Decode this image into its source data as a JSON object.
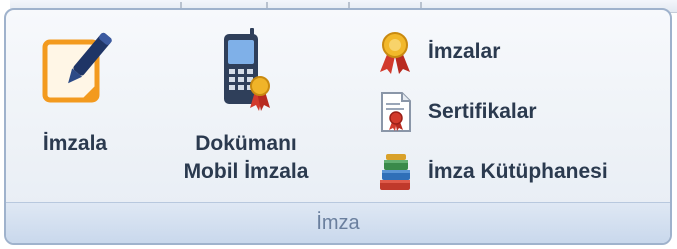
{
  "ribbon": {
    "group_label": "İmza",
    "buttons": {
      "sign": {
        "label": "İmzala",
        "icon": "sign-pen-icon"
      },
      "mobile_sign": {
        "label_line1": "Dokümanı",
        "label_line2": "Mobil İmzala",
        "icon": "mobile-phone-icon"
      },
      "signatures": {
        "label": "İmzalar",
        "icon": "award-ribbon-icon"
      },
      "certificates": {
        "label": "Sertifikalar",
        "icon": "certificate-document-icon"
      },
      "signature_library": {
        "label": "İmza Kütüphanesi",
        "icon": "books-icon"
      }
    }
  },
  "colors": {
    "text": "#2b3a4f",
    "group_border": "#9fb2cc",
    "footer_text": "#6a7f9e",
    "accent_orange": "#f39a1e",
    "accent_red": "#d23a2c",
    "accent_navy": "#1f3566"
  }
}
